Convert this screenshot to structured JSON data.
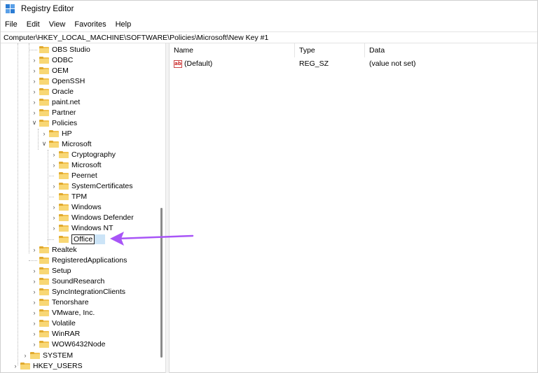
{
  "window": {
    "title": "Registry Editor"
  },
  "menu": {
    "items": [
      "File",
      "Edit",
      "View",
      "Favorites",
      "Help"
    ]
  },
  "address": {
    "path": "Computer\\HKEY_LOCAL_MACHINE\\SOFTWARE\\Policies\\Microsoft\\New Key #1"
  },
  "tree": {
    "items": [
      {
        "label": "OBS Studio",
        "expander": "none"
      },
      {
        "label": "ODBC",
        "expander": "collapsed"
      },
      {
        "label": "OEM",
        "expander": "collapsed"
      },
      {
        "label": "OpenSSH",
        "expander": "collapsed"
      },
      {
        "label": "Oracle",
        "expander": "collapsed"
      },
      {
        "label": "paint.net",
        "expander": "collapsed"
      },
      {
        "label": "Partner",
        "expander": "collapsed"
      },
      {
        "label": "Policies",
        "expander": "expanded"
      },
      {
        "label": "HP",
        "expander": "collapsed"
      },
      {
        "label": "Microsoft",
        "expander": "expanded"
      },
      {
        "label": "Cryptography",
        "expander": "collapsed"
      },
      {
        "label": "Microsoft",
        "expander": "collapsed"
      },
      {
        "label": "Peernet",
        "expander": "none"
      },
      {
        "label": "SystemCertificates",
        "expander": "collapsed"
      },
      {
        "label": "TPM",
        "expander": "none"
      },
      {
        "label": "Windows",
        "expander": "collapsed"
      },
      {
        "label": "Windows Defender",
        "expander": "collapsed"
      },
      {
        "label": "Windows NT",
        "expander": "collapsed"
      },
      {
        "label": "Office",
        "expander": "none",
        "editing": true
      },
      {
        "label": "Realtek",
        "expander": "collapsed"
      },
      {
        "label": "RegisteredApplications",
        "expander": "none"
      },
      {
        "label": "Setup",
        "expander": "collapsed"
      },
      {
        "label": "SoundResearch",
        "expander": "collapsed"
      },
      {
        "label": "SyncIntegrationClients",
        "expander": "collapsed"
      },
      {
        "label": "Tenorshare",
        "expander": "collapsed"
      },
      {
        "label": "VMware, Inc.",
        "expander": "collapsed"
      },
      {
        "label": "Volatile",
        "expander": "collapsed"
      },
      {
        "label": "WinRAR",
        "expander": "collapsed"
      },
      {
        "label": "WOW6432Node",
        "expander": "collapsed"
      },
      {
        "label": "SYSTEM",
        "expander": "collapsed"
      },
      {
        "label": "HKEY_USERS",
        "expander": "collapsed"
      }
    ]
  },
  "list": {
    "columns": [
      "Name",
      "Type",
      "Data"
    ],
    "rows": [
      {
        "name": "(Default)",
        "type": "REG_SZ",
        "data": "(value not set)",
        "icon": "ab-string-icon"
      }
    ]
  },
  "colors": {
    "accent_arrow": "#a855f7",
    "folder": "#f2c14e",
    "selection": "#cce4f7"
  }
}
